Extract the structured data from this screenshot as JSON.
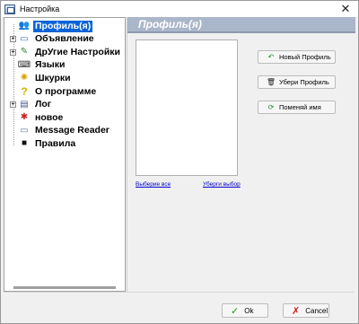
{
  "window": {
    "title": "Настройка",
    "close_glyph": "✕"
  },
  "tree": {
    "items": [
      {
        "label": "Профиль(я)",
        "icon": "profile-users-icon",
        "glyph": "👥",
        "expander": "",
        "selected": true
      },
      {
        "label": "Объявление",
        "icon": "keyboard-icon",
        "glyph": "▭",
        "expander": "+",
        "selected": false
      },
      {
        "label": "ДрУгие Настройки",
        "icon": "settings-brush-icon",
        "glyph": "✎",
        "expander": "+",
        "selected": false
      },
      {
        "label": "Языки",
        "icon": "languages-icon",
        "glyph": "⌨",
        "expander": "",
        "selected": false
      },
      {
        "label": "Шкурки",
        "icon": "skins-sun-icon",
        "glyph": "✺",
        "expander": "",
        "selected": false
      },
      {
        "label": "О программе",
        "icon": "question-icon",
        "glyph": "?",
        "expander": "",
        "selected": false
      },
      {
        "label": "Лог",
        "icon": "log-icon",
        "glyph": "▤",
        "expander": "+",
        "selected": false
      },
      {
        "label": "новое",
        "icon": "new-star-icon",
        "glyph": "✱",
        "expander": "",
        "selected": false
      },
      {
        "label": "Message Reader",
        "icon": "message-reader-icon",
        "glyph": "▭",
        "expander": "",
        "selected": false
      },
      {
        "label": "Правила",
        "icon": "rules-icon",
        "glyph": "■",
        "expander": "",
        "selected": false
      }
    ]
  },
  "panel": {
    "title": "Профиль(я)",
    "select_all": "Выберие все",
    "deselect": "Уберги выбор",
    "new_profile": "Новый Профиль",
    "delete_profile": "Убери Профиль",
    "rename": "Поменяй имя"
  },
  "dialog": {
    "ok": "Ok",
    "cancel": "Cancel"
  },
  "colors": {
    "selection": "#0a64d6",
    "header_band": "#aab6c9",
    "link": "#0000cc"
  }
}
